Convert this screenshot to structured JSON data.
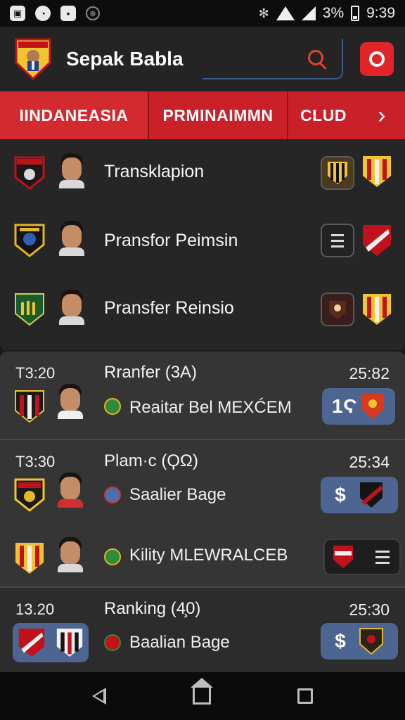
{
  "statusbar": {
    "battery_text": "3%",
    "time": "9:39",
    "icons": [
      "image-icon",
      "chat-icon",
      "messenger-icon",
      "globe-icon",
      "bluetooth-icon",
      "wifi-icon",
      "signal-icon",
      "battery-icon"
    ]
  },
  "appbar": {
    "title": "Sepak Babla",
    "accent": "#e0242a",
    "search_icon_color": "#e0442f"
  },
  "tabs": [
    {
      "label": "IINDANEASIA"
    },
    {
      "label": "PRMINAIMMN"
    },
    {
      "label": "CLUD"
    },
    {
      "label": "›"
    }
  ],
  "transfers": [
    {
      "label": "Transklapion",
      "action": "team-badge"
    },
    {
      "label": "Pransfor Peimsin",
      "action": "menu"
    },
    {
      "label": "Pransfer Reinsio",
      "action": "team-badge"
    }
  ],
  "matches": [
    {
      "time": "T3:20",
      "title": "Rranfer (3A)",
      "score": "25:82",
      "sub": "Reaitar Bel MEXĆEM",
      "pill_text": "1Ϛ"
    },
    {
      "time": "T3:30",
      "title": "Plam·c (ϘΩ)",
      "score": "25:34",
      "sub": "Saalier Bage",
      "pill_text": "$",
      "sub2": "Kility MLEWRALCEB"
    },
    {
      "time": "13.20",
      "title": "Ranking (4̧0)",
      "score": "25:30",
      "sub": "Baalian Bage",
      "pill_text": "$"
    }
  ],
  "colors": {
    "tab_red": "#c9202a",
    "pill_blue": "#4d6591",
    "background": "#1b1b1b"
  }
}
